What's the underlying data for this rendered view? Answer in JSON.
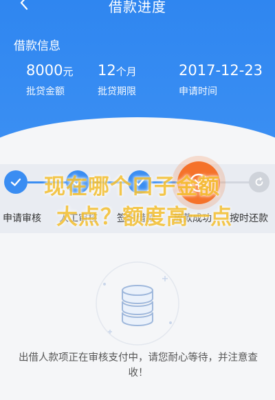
{
  "nav": {
    "title": "借款进度",
    "back_icon": "chevron-left-icon"
  },
  "loan_info": {
    "section_label": "借款信息",
    "amount": {
      "value": "8000",
      "unit": "元",
      "label": "批贷金额"
    },
    "term": {
      "value": "12",
      "unit": "个月",
      "label": "批贷期限"
    },
    "date": {
      "value": "2017-12-23",
      "label": "申请时间"
    }
  },
  "steps": [
    {
      "label": "申请审核",
      "state": "done"
    },
    {
      "label": "人工审核",
      "state": "done"
    },
    {
      "label": "签约借款",
      "state": "done"
    },
    {
      "label": "放款成功",
      "state": "current"
    },
    {
      "label": "按时还款",
      "state": "pending"
    }
  ],
  "overlay_text": {
    "line1": "现在哪个口子金额",
    "line2": "大点？额度高一点"
  },
  "status": {
    "message": "出借人款项正在审核支付中，请您耐心等待，并注意查收！",
    "icon": "database-icon"
  },
  "colors": {
    "primary": "#3a8df2",
    "current": "#f5722a",
    "overlay": "#f5c23a"
  }
}
